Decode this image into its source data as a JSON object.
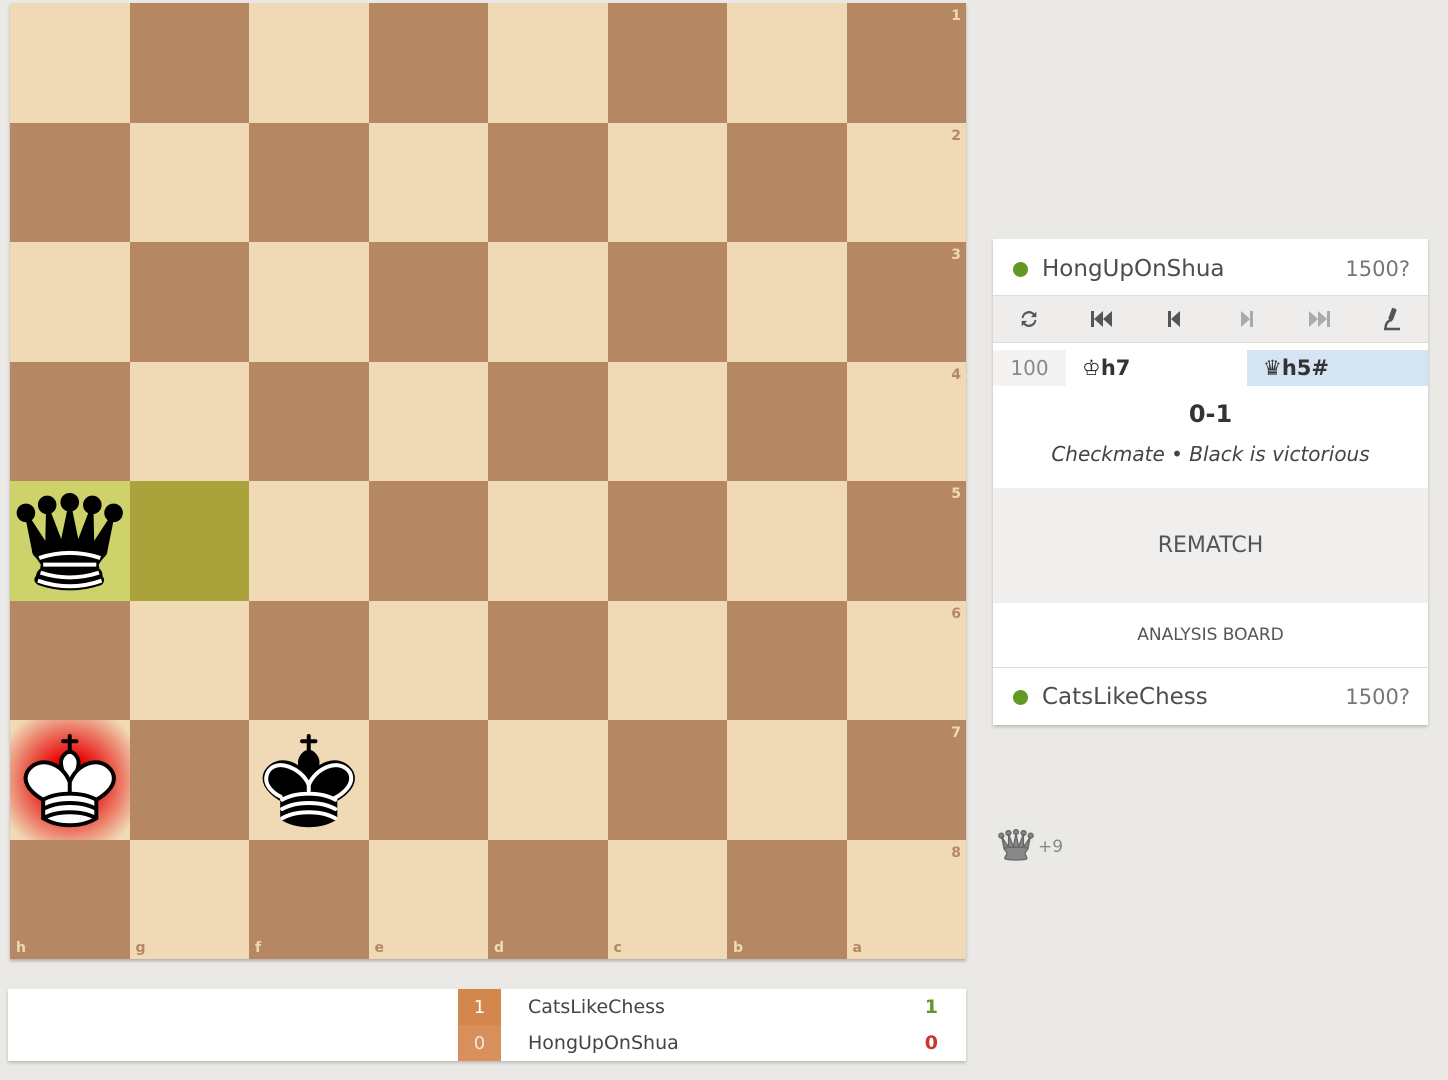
{
  "board": {
    "files": [
      "h",
      "g",
      "f",
      "e",
      "d",
      "c",
      "b",
      "a"
    ],
    "ranks": [
      "1",
      "2",
      "3",
      "4",
      "5",
      "6",
      "7",
      "8"
    ],
    "light_color": "#f0d9b5",
    "dark_color": "#b58863",
    "last_move_squares": [
      "h5",
      "g5"
    ],
    "check_square": "h7",
    "pieces": [
      {
        "square": "h5",
        "type": "queen",
        "color": "black"
      },
      {
        "square": "h7",
        "type": "king",
        "color": "white"
      },
      {
        "square": "f7",
        "type": "king",
        "color": "black"
      }
    ]
  },
  "panel": {
    "top_player": {
      "name": "HongUpOnShua",
      "rating": "1500?"
    },
    "bottom_player": {
      "name": "CatsLikeChess",
      "rating": "1500?"
    },
    "controls": [
      "flip-icon",
      "first-move-icon",
      "prev-move-icon",
      "next-move-icon",
      "last-move-icon",
      "analysis-icon"
    ],
    "moves": {
      "number": "100",
      "white": "♔h7",
      "black": "♛h5#"
    },
    "result": {
      "score": "0-1",
      "status": "Checkmate • Black is victorious"
    },
    "rematch_label": "REMATCH",
    "analysis_label": "ANALYSIS BOARD"
  },
  "material": {
    "piece": "queen-icon",
    "diff": "+9"
  },
  "scoreboard": [
    {
      "badge": "1",
      "name": "CatsLikeChess",
      "score": "1"
    },
    {
      "badge": "0",
      "name": "HongUpOnShua",
      "score": "0"
    }
  ],
  "accent": {
    "online": "#629924",
    "win": "#629924",
    "loss": "#cc3333",
    "badge": "#d4874c"
  }
}
